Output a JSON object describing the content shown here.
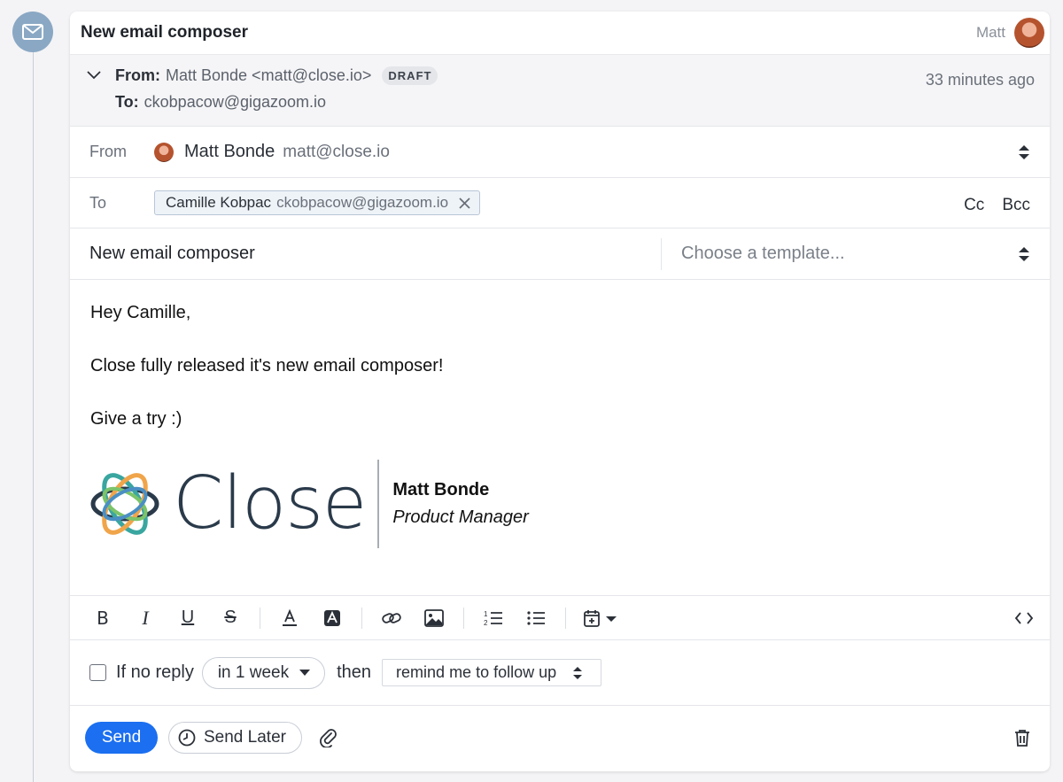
{
  "activity": {
    "icon": "envelope-icon",
    "title": "New email composer",
    "owner": "Matt"
  },
  "meta": {
    "from_label": "From:",
    "from_value": "Matt Bonde <matt@close.io>",
    "status": "DRAFT",
    "to_label": "To:",
    "to_value": "ckobpacow@gigazoom.io",
    "time": "33 minutes ago"
  },
  "composer": {
    "from_label": "From",
    "from_name": "Matt Bonde",
    "from_email": "matt@close.io",
    "to_label": "To",
    "recipient": {
      "name": "Camille Kobpac",
      "email": "ckobpacow@gigazoom.io"
    },
    "cc_label": "Cc",
    "bcc_label": "Bcc",
    "subject": "New email composer",
    "template_placeholder": "Choose a template...",
    "body": [
      "Hey Camille,",
      "Close fully released it's new email composer!",
      "Give a try :)"
    ],
    "signature": {
      "logo_text": "Close",
      "name": "Matt Bonde",
      "role": "Product Manager"
    }
  },
  "toolbar": {
    "bold": "B",
    "italic": "I",
    "underline": "U",
    "strike": "S"
  },
  "followup": {
    "prefix": "If no reply",
    "delay": "in 1 week",
    "then": "then",
    "action": "remind me to follow up"
  },
  "actions": {
    "send": "Send",
    "send_later": "Send Later"
  },
  "colors": {
    "primary": "#1b6ff0",
    "timeline_icon": "#8aa8c4",
    "logo_teal": "#3aa6a0",
    "logo_orange": "#f0a54a",
    "logo_navy": "#2a3a4a",
    "logo_green": "#7cc46a"
  }
}
